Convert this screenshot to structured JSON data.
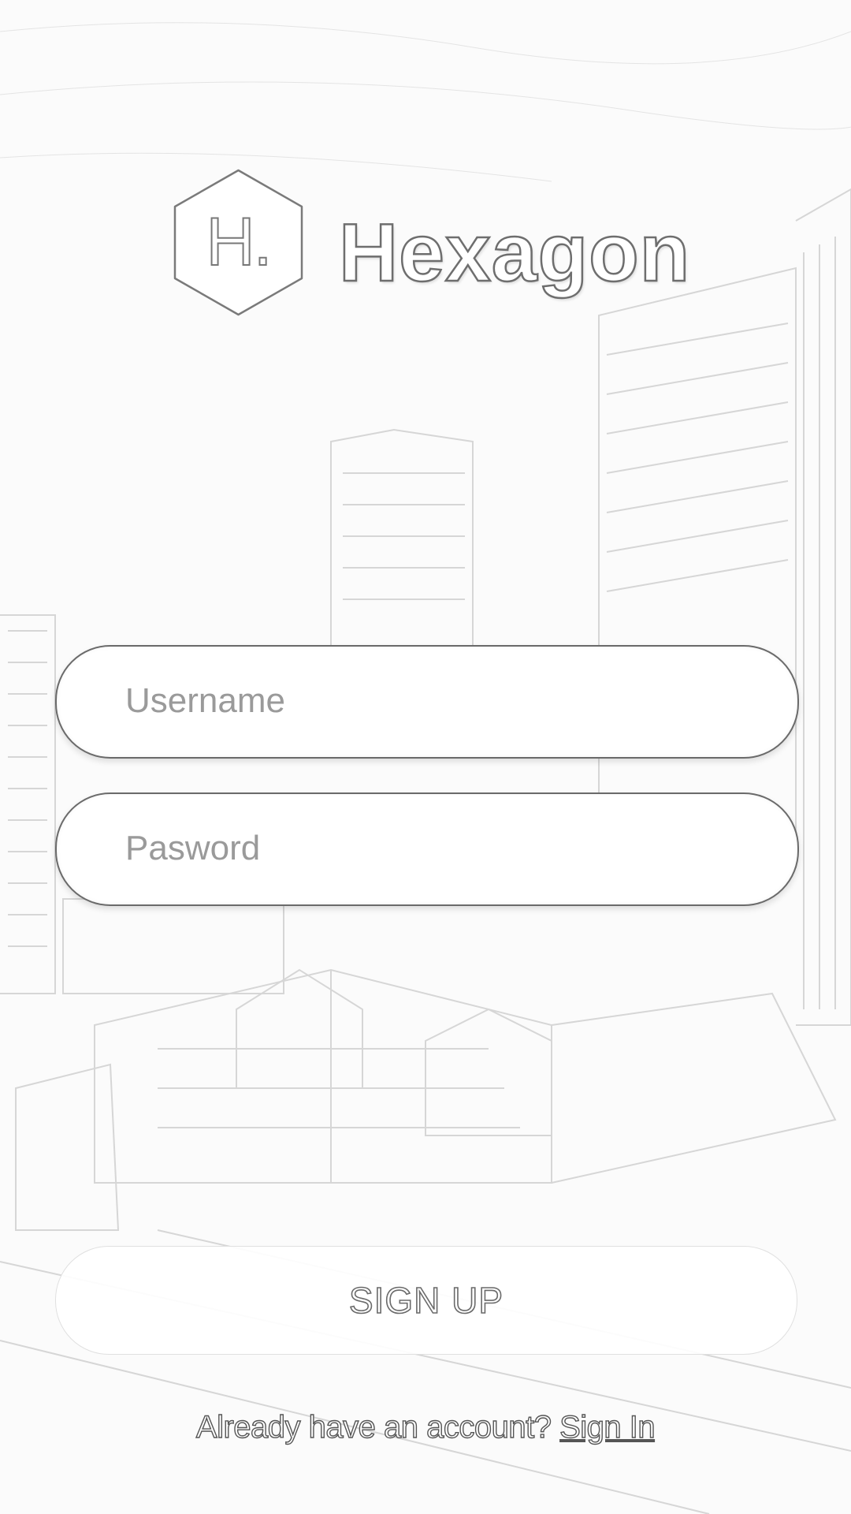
{
  "brand": {
    "logo_letter": "H.",
    "name": "Hexagon"
  },
  "form": {
    "username_placeholder": "Username",
    "password_placeholder": "Pasword"
  },
  "actions": {
    "signup_label": "SIGN UP"
  },
  "footer": {
    "prompt": "Already have an account? ",
    "signin_label": "Sign In"
  },
  "colors": {
    "background": "#fbfbfb",
    "field_bg": "#ffffff",
    "outline": "#6a6a6a"
  }
}
